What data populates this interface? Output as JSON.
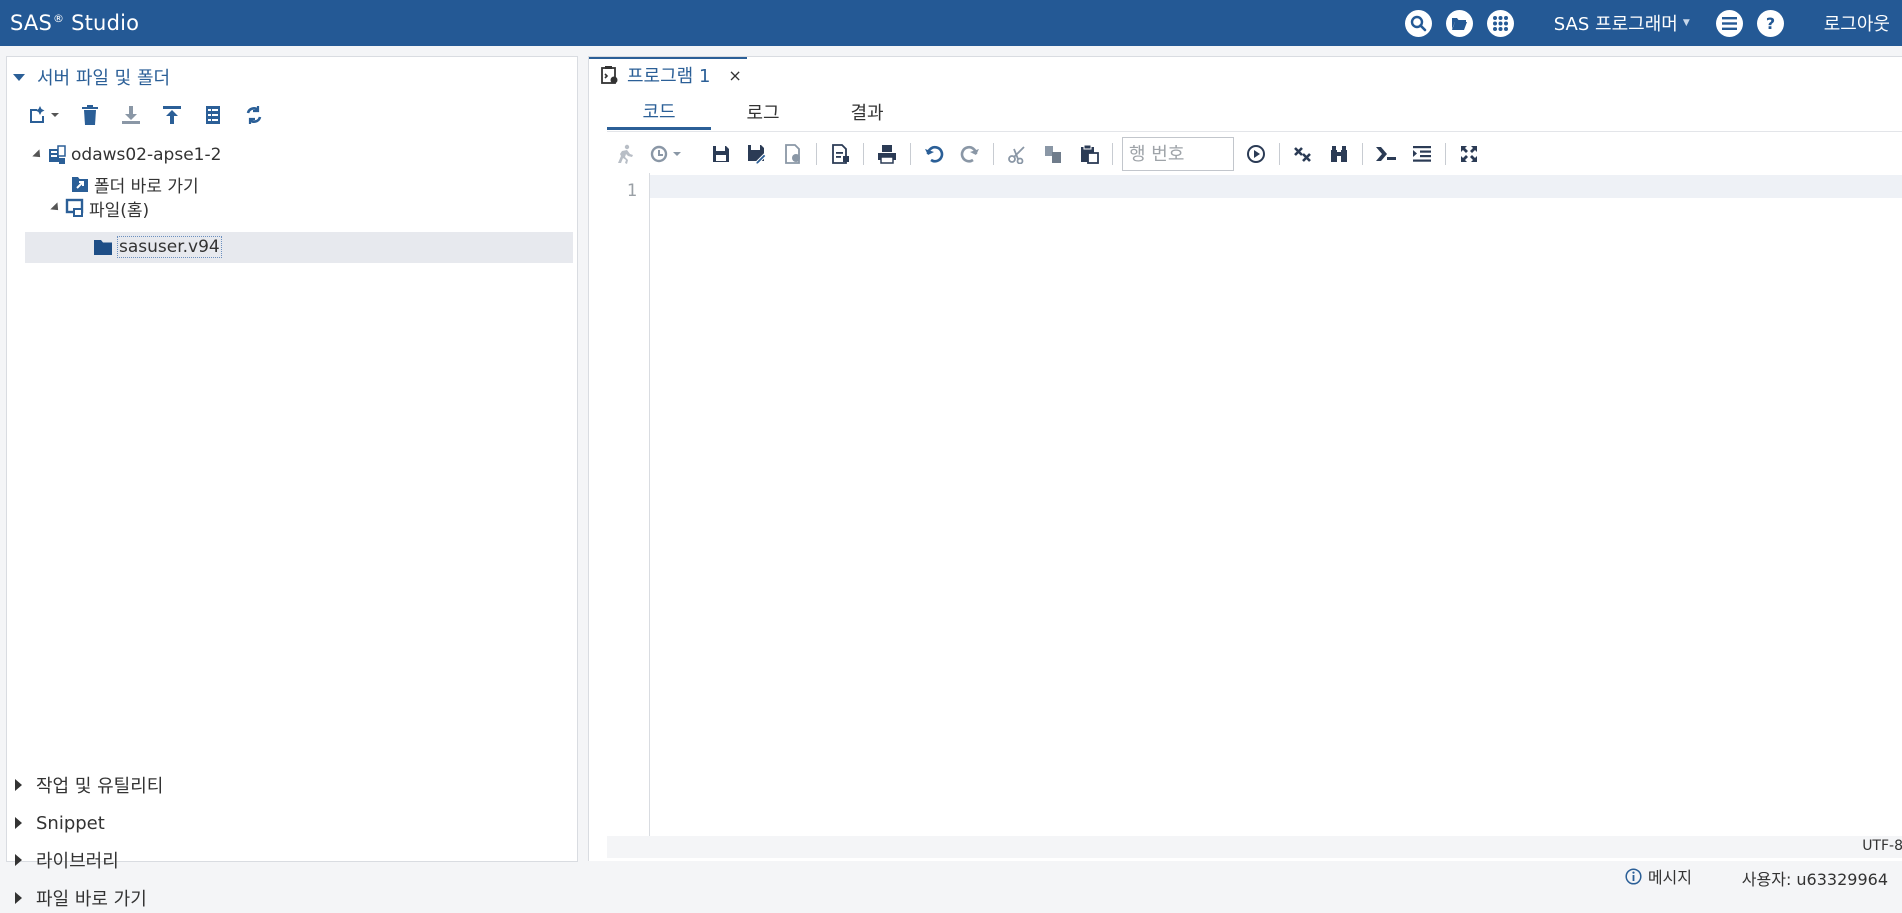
{
  "app": {
    "title_main": "SAS",
    "title_reg": "®",
    "title_rest": " Studio"
  },
  "header": {
    "role_label": "SAS 프로그래머",
    "logout_label": "로그아웃",
    "icons": [
      "search-icon",
      "folder-open-icon",
      "apps-grid-icon",
      "menu-icon",
      "help-icon"
    ]
  },
  "left_panel": {
    "open_section": "서버 파일 및 폴더",
    "toolbar_icons": [
      "new-item-icon",
      "delete-icon",
      "download-icon",
      "upload-icon",
      "properties-icon",
      "refresh-icon"
    ],
    "tree": {
      "server": "odaws02-apse1-2",
      "shortcut": "폴더 바로 가기",
      "home": "파일(홈)",
      "selected": "sasuser.v94"
    },
    "collapsed_sections": [
      "작업 및 유틸리티",
      "Snippet",
      "라이브러리",
      "파일 바로 가기"
    ]
  },
  "editor": {
    "doc_tab": "프로그램 1",
    "close_symbol": "×",
    "subtabs": [
      "코드",
      "로그",
      "결과"
    ],
    "active_subtab": "코드",
    "line_number_placeholder": "행 번호",
    "first_line_number": "1",
    "encoding": "UTF-8"
  },
  "status_bar": {
    "messages_label": "메시지",
    "user_label": "사용자: u63329964"
  },
  "colors": {
    "header": "#245995",
    "accent": "#2b5f97"
  }
}
